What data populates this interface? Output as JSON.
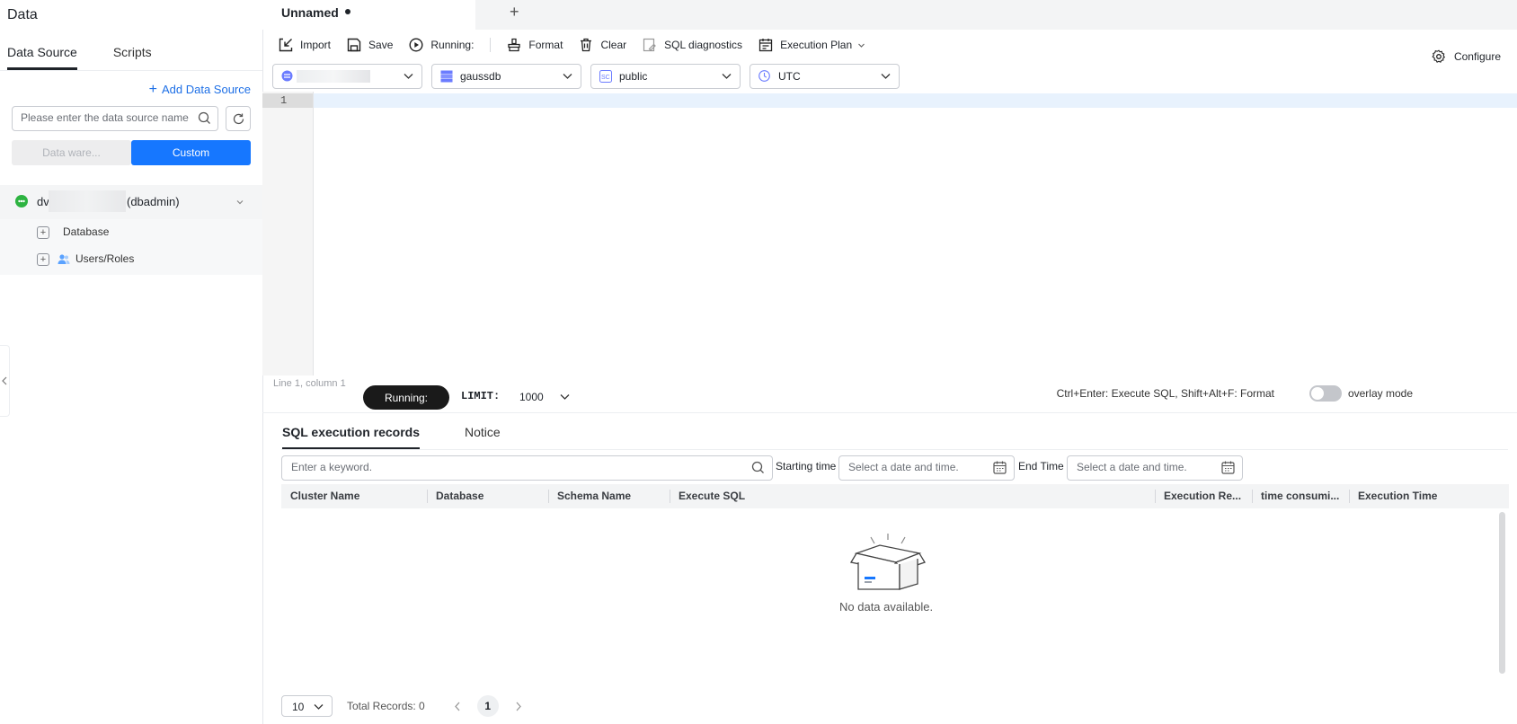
{
  "left": {
    "title": "Data",
    "tabs": [
      "Data Source",
      "Scripts"
    ],
    "add_data_source": "Add Data Source",
    "search_placeholder": "Please enter the data source name",
    "segment": {
      "left": "Data ware...",
      "right": "Custom"
    },
    "tree": {
      "root_prefix": "dv",
      "root_suffix": "(dbadmin)",
      "items": [
        "Database",
        "Users/Roles"
      ]
    }
  },
  "tabs": {
    "active": "Unnamed"
  },
  "toolbar": {
    "import": "Import",
    "save": "Save",
    "running": "Running:",
    "format": "Format",
    "clear": "Clear",
    "diagnostics": "SQL diagnostics",
    "plan": "Execution Plan",
    "configure": "Configure"
  },
  "selects": {
    "database": "gaussdb",
    "schema": "public",
    "timezone": "UTC"
  },
  "editor": {
    "line_number": "1",
    "position": "Line 1, column 1",
    "run_button": "Running:",
    "limit_label": "LIMIT:",
    "limit_value": "1000",
    "shortcuts": "Ctrl+Enter: Execute SQL, Shift+Alt+F: Format",
    "overlay_mode": "overlay mode"
  },
  "results": {
    "tabs": [
      "SQL execution records",
      "Notice"
    ],
    "keyword_placeholder": "Enter a keyword.",
    "starting_time_label": "Starting time",
    "end_time_label": "End Time",
    "date_placeholder": "Select a date and time.",
    "columns": [
      "Cluster Name",
      "Database",
      "Schema Name",
      "Execute SQL",
      "Execution Re...",
      "time consumi...",
      "Execution Time"
    ],
    "empty": "No data available.",
    "page_size": "10",
    "total": "Total Records: 0",
    "page": "1"
  },
  "colors": {
    "accent": "#1677ff",
    "link": "#1d6fe6",
    "run_button": "#1a1a1a",
    "status_ok": "#2db341"
  }
}
